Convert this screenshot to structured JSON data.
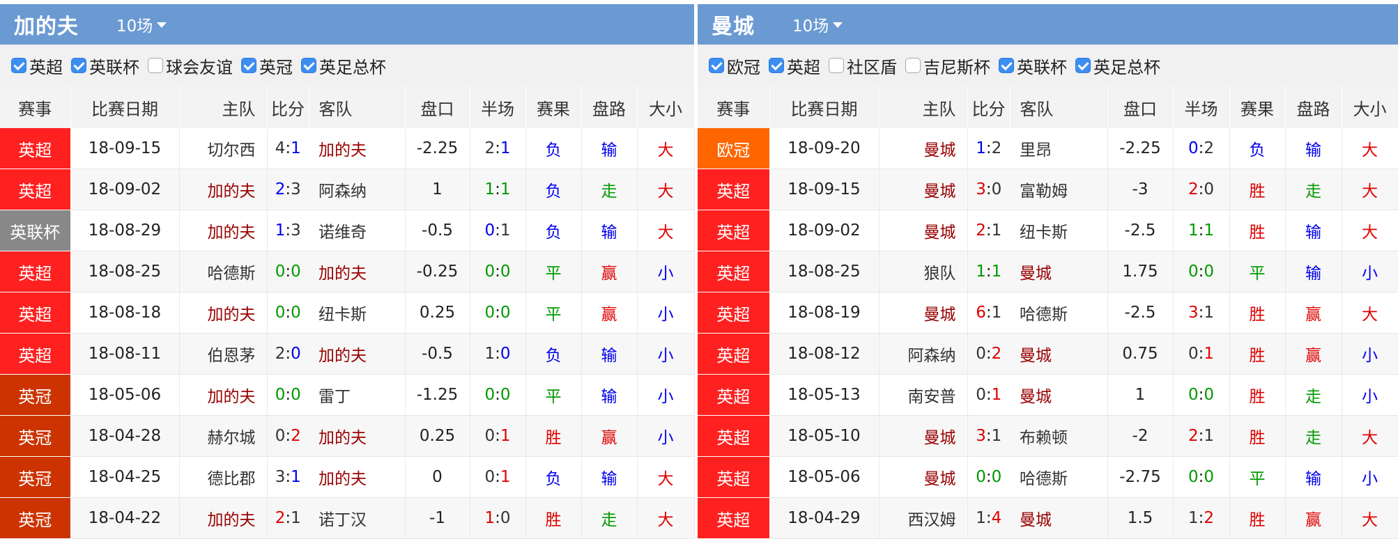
{
  "colors": {
    "header_bg": "#6b9ad2",
    "win": "#e00000",
    "draw": "#009900",
    "loss": "#0000ee",
    "team_highlight": "#990000",
    "league_epl": "#ff2020",
    "league_efl_cup": "#888888",
    "league_championship": "#cc3300",
    "league_europa": "#ff6600"
  },
  "columns": [
    "赛事",
    "比赛日期",
    "主队",
    "比分",
    "客队",
    "盘口",
    "半场",
    "赛果",
    "盘路",
    "大小"
  ],
  "left": {
    "team": "加的夫",
    "count_label": "10场",
    "filters": [
      {
        "label": "英超",
        "checked": true
      },
      {
        "label": "英联杯",
        "checked": true
      },
      {
        "label": "球会友谊",
        "checked": false
      },
      {
        "label": "英冠",
        "checked": true
      },
      {
        "label": "英足总杯",
        "checked": true
      }
    ],
    "rows": [
      {
        "league": "英超",
        "league_color": "#ff2020",
        "date": "18-09-15",
        "home": "切尔西",
        "home_color": "#333333",
        "score_h": "4",
        "score_a": "1",
        "sh_color": "#333333",
        "sa_color": "#0000ee",
        "away": "加的夫",
        "away_color": "#990000",
        "handicap": "-2.25",
        "ht_h": "2",
        "ht_a": "1",
        "hth_color": "#333333",
        "hta_color": "#0000ee",
        "result": "负",
        "result_color": "#0000ee",
        "ah": "输",
        "ah_color": "#0000ee",
        "ou": "大",
        "ou_color": "#e00000"
      },
      {
        "league": "英超",
        "league_color": "#ff2020",
        "date": "18-09-02",
        "home": "加的夫",
        "home_color": "#990000",
        "score_h": "2",
        "score_a": "3",
        "sh_color": "#0000ee",
        "sa_color": "#333333",
        "away": "阿森纳",
        "away_color": "#333333",
        "handicap": "1",
        "ht_h": "1",
        "ht_a": "1",
        "hth_color": "#009900",
        "hta_color": "#009900",
        "result": "负",
        "result_color": "#0000ee",
        "ah": "走",
        "ah_color": "#009900",
        "ou": "大",
        "ou_color": "#e00000"
      },
      {
        "league": "英联杯",
        "league_color": "#888888",
        "date": "18-08-29",
        "home": "加的夫",
        "home_color": "#990000",
        "score_h": "1",
        "score_a": "3",
        "sh_color": "#0000ee",
        "sa_color": "#333333",
        "away": "诺维奇",
        "away_color": "#333333",
        "handicap": "-0.5",
        "ht_h": "0",
        "ht_a": "1",
        "hth_color": "#0000ee",
        "hta_color": "#333333",
        "result": "负",
        "result_color": "#0000ee",
        "ah": "输",
        "ah_color": "#0000ee",
        "ou": "大",
        "ou_color": "#e00000"
      },
      {
        "league": "英超",
        "league_color": "#ff2020",
        "date": "18-08-25",
        "home": "哈德斯",
        "home_color": "#333333",
        "score_h": "0",
        "score_a": "0",
        "sh_color": "#009900",
        "sa_color": "#009900",
        "away": "加的夫",
        "away_color": "#990000",
        "handicap": "-0.25",
        "ht_h": "0",
        "ht_a": "0",
        "hth_color": "#009900",
        "hta_color": "#009900",
        "result": "平",
        "result_color": "#009900",
        "ah": "赢",
        "ah_color": "#e00000",
        "ou": "小",
        "ou_color": "#0000ee"
      },
      {
        "league": "英超",
        "league_color": "#ff2020",
        "date": "18-08-18",
        "home": "加的夫",
        "home_color": "#990000",
        "score_h": "0",
        "score_a": "0",
        "sh_color": "#009900",
        "sa_color": "#009900",
        "away": "纽卡斯",
        "away_color": "#333333",
        "handicap": "0.25",
        "ht_h": "0",
        "ht_a": "0",
        "hth_color": "#009900",
        "hta_color": "#009900",
        "result": "平",
        "result_color": "#009900",
        "ah": "赢",
        "ah_color": "#e00000",
        "ou": "小",
        "ou_color": "#0000ee"
      },
      {
        "league": "英超",
        "league_color": "#ff2020",
        "date": "18-08-11",
        "home": "伯恩茅",
        "home_color": "#333333",
        "score_h": "2",
        "score_a": "0",
        "sh_color": "#333333",
        "sa_color": "#0000ee",
        "away": "加的夫",
        "away_color": "#990000",
        "handicap": "-0.5",
        "ht_h": "1",
        "ht_a": "0",
        "hth_color": "#333333",
        "hta_color": "#0000ee",
        "result": "负",
        "result_color": "#0000ee",
        "ah": "输",
        "ah_color": "#0000ee",
        "ou": "小",
        "ou_color": "#0000ee"
      },
      {
        "league": "英冠",
        "league_color": "#cc3300",
        "date": "18-05-06",
        "home": "加的夫",
        "home_color": "#990000",
        "score_h": "0",
        "score_a": "0",
        "sh_color": "#009900",
        "sa_color": "#009900",
        "away": "雷丁",
        "away_color": "#333333",
        "handicap": "-1.25",
        "ht_h": "0",
        "ht_a": "0",
        "hth_color": "#009900",
        "hta_color": "#009900",
        "result": "平",
        "result_color": "#009900",
        "ah": "输",
        "ah_color": "#0000ee",
        "ou": "小",
        "ou_color": "#0000ee"
      },
      {
        "league": "英冠",
        "league_color": "#cc3300",
        "date": "18-04-28",
        "home": "赫尔城",
        "home_color": "#333333",
        "score_h": "0",
        "score_a": "2",
        "sh_color": "#333333",
        "sa_color": "#e00000",
        "away": "加的夫",
        "away_color": "#990000",
        "handicap": "0.25",
        "ht_h": "0",
        "ht_a": "1",
        "hth_color": "#333333",
        "hta_color": "#e00000",
        "result": "胜",
        "result_color": "#e00000",
        "ah": "赢",
        "ah_color": "#e00000",
        "ou": "小",
        "ou_color": "#0000ee"
      },
      {
        "league": "英冠",
        "league_color": "#cc3300",
        "date": "18-04-25",
        "home": "德比郡",
        "home_color": "#333333",
        "score_h": "3",
        "score_a": "1",
        "sh_color": "#333333",
        "sa_color": "#0000ee",
        "away": "加的夫",
        "away_color": "#990000",
        "handicap": "0",
        "ht_h": "0",
        "ht_a": "1",
        "hth_color": "#333333",
        "hta_color": "#e00000",
        "result": "负",
        "result_color": "#0000ee",
        "ah": "输",
        "ah_color": "#0000ee",
        "ou": "大",
        "ou_color": "#e00000"
      },
      {
        "league": "英冠",
        "league_color": "#cc3300",
        "date": "18-04-22",
        "home": "加的夫",
        "home_color": "#990000",
        "score_h": "2",
        "score_a": "1",
        "sh_color": "#e00000",
        "sa_color": "#333333",
        "away": "诺丁汉",
        "away_color": "#333333",
        "handicap": "-1",
        "ht_h": "1",
        "ht_a": "0",
        "hth_color": "#e00000",
        "hta_color": "#333333",
        "result": "胜",
        "result_color": "#e00000",
        "ah": "走",
        "ah_color": "#009900",
        "ou": "大",
        "ou_color": "#e00000"
      }
    ]
  },
  "right": {
    "team": "曼城",
    "count_label": "10场",
    "filters": [
      {
        "label": "欧冠",
        "checked": true
      },
      {
        "label": "英超",
        "checked": true
      },
      {
        "label": "社区盾",
        "checked": false
      },
      {
        "label": "吉尼斯杯",
        "checked": false
      },
      {
        "label": "英联杯",
        "checked": true
      },
      {
        "label": "英足总杯",
        "checked": true
      }
    ],
    "rows": [
      {
        "league": "欧冠",
        "league_color": "#ff6600",
        "date": "18-09-20",
        "home": "曼城",
        "home_color": "#990000",
        "score_h": "1",
        "score_a": "2",
        "sh_color": "#0000ee",
        "sa_color": "#333333",
        "away": "里昂",
        "away_color": "#333333",
        "handicap": "-2.25",
        "ht_h": "0",
        "ht_a": "2",
        "hth_color": "#0000ee",
        "hta_color": "#333333",
        "result": "负",
        "result_color": "#0000ee",
        "ah": "输",
        "ah_color": "#0000ee",
        "ou": "大",
        "ou_color": "#e00000"
      },
      {
        "league": "英超",
        "league_color": "#ff2020",
        "date": "18-09-15",
        "home": "曼城",
        "home_color": "#990000",
        "score_h": "3",
        "score_a": "0",
        "sh_color": "#e00000",
        "sa_color": "#333333",
        "away": "富勒姆",
        "away_color": "#333333",
        "handicap": "-3",
        "ht_h": "2",
        "ht_a": "0",
        "hth_color": "#e00000",
        "hta_color": "#333333",
        "result": "胜",
        "result_color": "#e00000",
        "ah": "走",
        "ah_color": "#009900",
        "ou": "大",
        "ou_color": "#e00000"
      },
      {
        "league": "英超",
        "league_color": "#ff2020",
        "date": "18-09-02",
        "home": "曼城",
        "home_color": "#990000",
        "score_h": "2",
        "score_a": "1",
        "sh_color": "#e00000",
        "sa_color": "#333333",
        "away": "纽卡斯",
        "away_color": "#333333",
        "handicap": "-2.5",
        "ht_h": "1",
        "ht_a": "1",
        "hth_color": "#009900",
        "hta_color": "#009900",
        "result": "胜",
        "result_color": "#e00000",
        "ah": "输",
        "ah_color": "#0000ee",
        "ou": "大",
        "ou_color": "#e00000"
      },
      {
        "league": "英超",
        "league_color": "#ff2020",
        "date": "18-08-25",
        "home": "狼队",
        "home_color": "#333333",
        "score_h": "1",
        "score_a": "1",
        "sh_color": "#009900",
        "sa_color": "#009900",
        "away": "曼城",
        "away_color": "#990000",
        "handicap": "1.75",
        "ht_h": "0",
        "ht_a": "0",
        "hth_color": "#009900",
        "hta_color": "#009900",
        "result": "平",
        "result_color": "#009900",
        "ah": "输",
        "ah_color": "#0000ee",
        "ou": "小",
        "ou_color": "#0000ee"
      },
      {
        "league": "英超",
        "league_color": "#ff2020",
        "date": "18-08-19",
        "home": "曼城",
        "home_color": "#990000",
        "score_h": "6",
        "score_a": "1",
        "sh_color": "#e00000",
        "sa_color": "#333333",
        "away": "哈德斯",
        "away_color": "#333333",
        "handicap": "-2.5",
        "ht_h": "3",
        "ht_a": "1",
        "hth_color": "#e00000",
        "hta_color": "#333333",
        "result": "胜",
        "result_color": "#e00000",
        "ah": "赢",
        "ah_color": "#e00000",
        "ou": "大",
        "ou_color": "#e00000"
      },
      {
        "league": "英超",
        "league_color": "#ff2020",
        "date": "18-08-12",
        "home": "阿森纳",
        "home_color": "#333333",
        "score_h": "0",
        "score_a": "2",
        "sh_color": "#333333",
        "sa_color": "#e00000",
        "away": "曼城",
        "away_color": "#990000",
        "handicap": "0.75",
        "ht_h": "0",
        "ht_a": "1",
        "hth_color": "#333333",
        "hta_color": "#e00000",
        "result": "胜",
        "result_color": "#e00000",
        "ah": "赢",
        "ah_color": "#e00000",
        "ou": "小",
        "ou_color": "#0000ee"
      },
      {
        "league": "英超",
        "league_color": "#ff2020",
        "date": "18-05-13",
        "home": "南安普",
        "home_color": "#333333",
        "score_h": "0",
        "score_a": "1",
        "sh_color": "#333333",
        "sa_color": "#e00000",
        "away": "曼城",
        "away_color": "#990000",
        "handicap": "1",
        "ht_h": "0",
        "ht_a": "0",
        "hth_color": "#009900",
        "hta_color": "#009900",
        "result": "胜",
        "result_color": "#e00000",
        "ah": "走",
        "ah_color": "#009900",
        "ou": "小",
        "ou_color": "#0000ee"
      },
      {
        "league": "英超",
        "league_color": "#ff2020",
        "date": "18-05-10",
        "home": "曼城",
        "home_color": "#990000",
        "score_h": "3",
        "score_a": "1",
        "sh_color": "#e00000",
        "sa_color": "#333333",
        "away": "布赖顿",
        "away_color": "#333333",
        "handicap": "-2",
        "ht_h": "2",
        "ht_a": "1",
        "hth_color": "#e00000",
        "hta_color": "#333333",
        "result": "胜",
        "result_color": "#e00000",
        "ah": "走",
        "ah_color": "#009900",
        "ou": "大",
        "ou_color": "#e00000"
      },
      {
        "league": "英超",
        "league_color": "#ff2020",
        "date": "18-05-06",
        "home": "曼城",
        "home_color": "#990000",
        "score_h": "0",
        "score_a": "0",
        "sh_color": "#009900",
        "sa_color": "#009900",
        "away": "哈德斯",
        "away_color": "#333333",
        "handicap": "-2.75",
        "ht_h": "0",
        "ht_a": "0",
        "hth_color": "#009900",
        "hta_color": "#009900",
        "result": "平",
        "result_color": "#009900",
        "ah": "输",
        "ah_color": "#0000ee",
        "ou": "小",
        "ou_color": "#0000ee"
      },
      {
        "league": "英超",
        "league_color": "#ff2020",
        "date": "18-04-29",
        "home": "西汉姆",
        "home_color": "#333333",
        "score_h": "1",
        "score_a": "4",
        "sh_color": "#333333",
        "sa_color": "#e00000",
        "away": "曼城",
        "away_color": "#990000",
        "handicap": "1.5",
        "ht_h": "1",
        "ht_a": "2",
        "hth_color": "#333333",
        "hta_color": "#e00000",
        "result": "胜",
        "result_color": "#e00000",
        "ah": "赢",
        "ah_color": "#e00000",
        "ou": "大",
        "ou_color": "#e00000"
      }
    ]
  }
}
